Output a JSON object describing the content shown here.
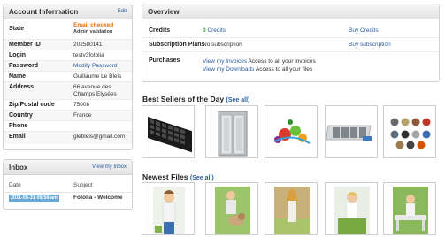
{
  "account": {
    "title": "Account Information",
    "edit": "Edit",
    "rows": [
      {
        "label": "State",
        "value": "Email checked",
        "sub": "Admin validation"
      },
      {
        "label": "Member ID",
        "value": "202580141"
      },
      {
        "label": "Login",
        "value": "testv3fotolia"
      },
      {
        "label": "Password",
        "value": "Modify Password"
      },
      {
        "label": "Name",
        "value": "Guillaume Le Bleis"
      },
      {
        "label": "Address",
        "value": "66 avenue des Champs Elysées"
      },
      {
        "label": "Zip/Postal code",
        "value": "75008"
      },
      {
        "label": "Country",
        "value": "France"
      },
      {
        "label": "Phone",
        "value": ""
      },
      {
        "label": "Email",
        "value": "glebleis@gmail.com"
      }
    ]
  },
  "inbox": {
    "title": "Inbox",
    "view": "View my Inbox",
    "col_date": "Date",
    "col_subject": "Subject",
    "message": {
      "date": "2011-05-31 09:58 am",
      "subject": "Fotolia - Welcome"
    }
  },
  "overview": {
    "title": "Overview",
    "credits_label": "Credits",
    "credits_count": "0",
    "credits_word": "Credits",
    "buy_credits": "Buy Credits",
    "subs_label": "Subscription Plans",
    "subs_value": "No subscription",
    "buy_subs": "Buy subscription",
    "purchases_label": "Purchases",
    "invoices_link": "View my Invoices",
    "invoices_text": "Access to all your invoices",
    "downloads_link": "View my Downloads",
    "downloads_text": "Access to all your files"
  },
  "best_sellers": {
    "title": "Best Sellers of the Day",
    "see_all": "(See all)"
  },
  "newest": {
    "title": "Newest Files",
    "see_all": "(See all)"
  }
}
